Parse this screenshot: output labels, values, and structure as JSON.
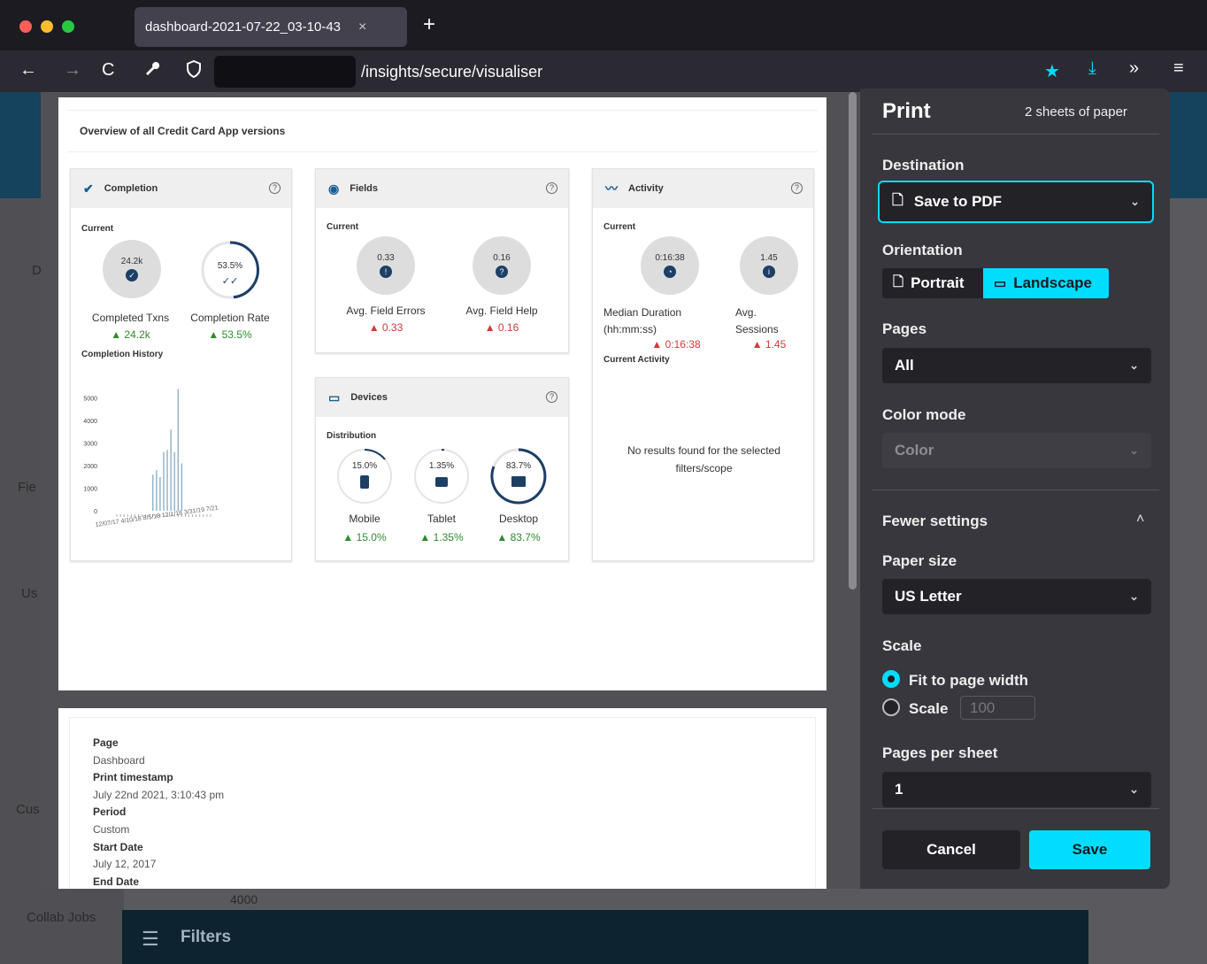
{
  "browser": {
    "tab_title": "dashboard-2021-07-22_03-10-43",
    "tab_close": "×",
    "new_tab": "+",
    "url": "/insights/secure/visualiser",
    "icons": [
      "back-icon",
      "forward-icon",
      "reload-icon",
      "wrench-icon",
      "shield-icon",
      "star-icon",
      "download-icon",
      "overflow-icon",
      "menu-icon"
    ]
  },
  "app_background": {
    "side_labels": [
      "D",
      "Fie",
      "Us",
      "Cus",
      "Collab Jobs"
    ],
    "table_value": "4000",
    "filters_label": "Filters"
  },
  "report": {
    "title": "Overview of all Credit Card App versions",
    "completion": {
      "header": "Completion",
      "current_label": "Current",
      "txns_value": "24.2k",
      "rate_value": "53.5%",
      "txns_label": "Completed Txns",
      "rate_label": "Completion Rate",
      "txns_delta": "▲ 24.2k",
      "rate_delta": "▲ 53.5%",
      "history_label": "Completion History",
      "help": "?"
    },
    "fields": {
      "header": "Fields",
      "current_label": "Current",
      "errors_value": "0.33",
      "help_value": "0.16",
      "errors_label": "Avg. Field Errors",
      "help_label": "Avg. Field Help",
      "errors_delta": "▲ 0.33",
      "help_delta": "▲ 0.16",
      "help": "?"
    },
    "devices": {
      "header": "Devices",
      "distribution_label": "Distribution",
      "mobile_value": "15.0%",
      "tablet_value": "1.35%",
      "desktop_value": "83.7%",
      "mobile_label": "Mobile",
      "tablet_label": "Tablet",
      "desktop_label": "Desktop",
      "mobile_delta": "▲ 15.0%",
      "tablet_delta": "▲ 1.35%",
      "desktop_delta": "▲ 83.7%",
      "help": "?"
    },
    "activity": {
      "header": "Activity",
      "current_label": "Current",
      "duration_value": "0:16:38",
      "sessions_value": "1.45",
      "duration_label": "Median Duration (hh:mm:ss)",
      "sessions_label": "Avg. Sessions",
      "duration_delta": "▲ 0:16:38",
      "sessions_delta": "▲ 1.45",
      "current_activity_label": "Current Activity",
      "empty_message": "No results found for the selected filters/scope",
      "help": "?"
    },
    "meta": [
      {
        "key": "Page",
        "value": "Dashboard"
      },
      {
        "key": "Print timestamp",
        "value": "July 22nd 2021, 3:10:43 pm"
      },
      {
        "key": "Period",
        "value": "Custom"
      },
      {
        "key": "Start Date",
        "value": "July 12, 2017"
      },
      {
        "key": "End Date",
        "value": ""
      }
    ]
  },
  "chart_data": {
    "type": "bar",
    "title": "Completion History",
    "yticks": [
      "5000",
      "4000",
      "3000",
      "2000",
      "1000",
      "0"
    ],
    "ylim": [
      0,
      5500
    ],
    "values": [
      0,
      0,
      0,
      0,
      0,
      0,
      0,
      0,
      0,
      0,
      1600,
      1800,
      1500,
      2600,
      2700,
      3600,
      2600,
      5400,
      2100,
      0,
      0,
      0,
      0,
      0,
      0,
      0,
      0
    ],
    "xlabel": "",
    "ylabel": ""
  },
  "print_dialog": {
    "title": "Print",
    "sheets": "2 sheets of paper",
    "destination_label": "Destination",
    "destination_value": "Save to PDF",
    "orientation_label": "Orientation",
    "portrait": "Portrait",
    "landscape": "Landscape",
    "pages_label": "Pages",
    "pages_value": "All",
    "color_mode_label": "Color mode",
    "color_mode_value": "Color",
    "fewer_settings": "Fewer settings",
    "paper_size_label": "Paper size",
    "paper_size_value": "US Letter",
    "scale_label": "Scale",
    "fit_option": "Fit to page width",
    "scale_option": "Scale",
    "scale_value": "100",
    "pages_per_sheet_label": "Pages per sheet",
    "pages_per_sheet_value": "1",
    "cancel": "Cancel",
    "save": "Save",
    "accent": "#00ddff"
  }
}
